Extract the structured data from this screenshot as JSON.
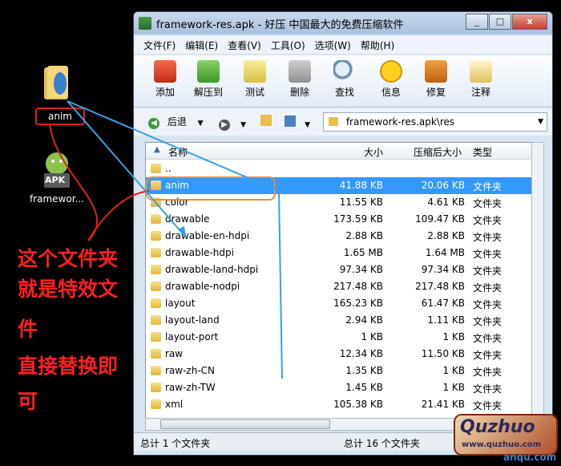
{
  "desktop": {
    "icon1_label": "anim",
    "icon2_label": "framewor...",
    "apk_badge": "APK",
    "annotation_lines": [
      "这个文件夹",
      "就是特效文",
      "件",
      "直接替换即",
      "可"
    ]
  },
  "window": {
    "title": "framework-res.apk - 好压 中国最大的免费压缩软件",
    "menu": [
      "文件(F)",
      "编辑(E)",
      "查看(V)",
      "工具(O)",
      "选项(W)",
      "帮助(H)"
    ],
    "toolbar": [
      "添加",
      "解压到",
      "测试",
      "删除",
      "查找",
      "信息",
      "修复",
      "注释"
    ],
    "nav": {
      "back_label": "后退",
      "address": "framework-res.apk\\res"
    },
    "columns": [
      "名称",
      "大小",
      "压缩后大小",
      "类型"
    ],
    "rows": [
      {
        "name": "..",
        "size": "",
        "csize": "",
        "type": ""
      },
      {
        "name": "anim",
        "size": "41.88 KB",
        "csize": "20.06 KB",
        "type": "文件夹"
      },
      {
        "name": "color",
        "size": "11.55 KB",
        "csize": "4.61 KB",
        "type": "文件夹"
      },
      {
        "name": "drawable",
        "size": "173.59 KB",
        "csize": "109.47 KB",
        "type": "文件夹"
      },
      {
        "name": "drawable-en-hdpi",
        "size": "2.88 KB",
        "csize": "2.88 KB",
        "type": "文件夹"
      },
      {
        "name": "drawable-hdpi",
        "size": "1.65 MB",
        "csize": "1.64 MB",
        "type": "文件夹"
      },
      {
        "name": "drawable-land-hdpi",
        "size": "97.34 KB",
        "csize": "97.34 KB",
        "type": "文件夹"
      },
      {
        "name": "drawable-nodpi",
        "size": "217.48 KB",
        "csize": "217.48 KB",
        "type": "文件夹"
      },
      {
        "name": "layout",
        "size": "165.23 KB",
        "csize": "61.47 KB",
        "type": "文件夹"
      },
      {
        "name": "layout-land",
        "size": "2.94 KB",
        "csize": "1.11 KB",
        "type": "文件夹"
      },
      {
        "name": "layout-port",
        "size": "1 KB",
        "csize": "1 KB",
        "type": "文件夹"
      },
      {
        "name": "raw",
        "size": "12.34 KB",
        "csize": "11.50 KB",
        "type": "文件夹"
      },
      {
        "name": "raw-zh-CN",
        "size": "1.35 KB",
        "csize": "1 KB",
        "type": "文件夹"
      },
      {
        "name": "raw-zh-TW",
        "size": "1.45 KB",
        "csize": "1 KB",
        "type": "文件夹"
      },
      {
        "name": "xml",
        "size": "105.38 KB",
        "csize": "21.41 KB",
        "type": "文件夹"
      }
    ],
    "status_left": "总计 1 个文件夹",
    "status_right": "总计 16 个文件夹"
  },
  "watermark": {
    "main": "Quzhuo",
    "sub": "www.quzhuo.com",
    "under": "anqu.com"
  },
  "colors": {
    "annotation": "#ff2020",
    "selection": "#3399ff",
    "highlight_box": "#f08a30"
  }
}
